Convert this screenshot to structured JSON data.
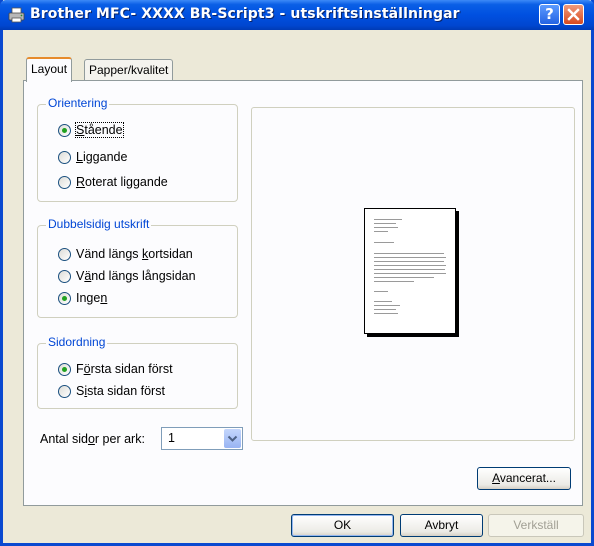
{
  "window": {
    "title": "Brother MFC- XXXX BR-Script3 - utskriftsinställningar",
    "help_label": "?",
    "close_label": "✕"
  },
  "tabs": [
    {
      "label": "Layout",
      "active": true
    },
    {
      "label": "Papper/kvalitet",
      "active": false
    }
  ],
  "orientation": {
    "title": "Orientering",
    "options": [
      {
        "pre": "",
        "acc": "S",
        "post": "tående",
        "selected": true
      },
      {
        "pre": "",
        "acc": "L",
        "post": "iggande",
        "selected": false
      },
      {
        "pre": "",
        "acc": "R",
        "post": "oterat liggande",
        "selected": false
      }
    ]
  },
  "duplex": {
    "title": "Dubbelsidig utskrift",
    "options": [
      {
        "pre": "Vänd längs ",
        "acc": "k",
        "post": "ortsidan",
        "selected": false
      },
      {
        "pre": "V",
        "acc": "ä",
        "post": "nd längs långsidan",
        "selected": false
      },
      {
        "pre": "Inge",
        "acc": "n",
        "post": "",
        "selected": true
      }
    ]
  },
  "page_order": {
    "title": "Sidordning",
    "options": [
      {
        "pre": "F",
        "acc": "ö",
        "post": "rsta sidan först",
        "selected": true
      },
      {
        "pre": "S",
        "acc": "i",
        "post": "sta sidan först",
        "selected": false
      }
    ]
  },
  "pages_per_sheet": {
    "label_pre": "Antal sid",
    "label_acc": "o",
    "label_post": "r per ark:",
    "value": "1"
  },
  "buttons": {
    "advanced_acc": "A",
    "advanced_post": "vancerat...",
    "ok": "OK",
    "cancel": "Avbryt",
    "apply": "Verkställ"
  },
  "icons": {
    "title_icon": "printer-icon",
    "dropdown_icon": "chevron-down-icon"
  }
}
